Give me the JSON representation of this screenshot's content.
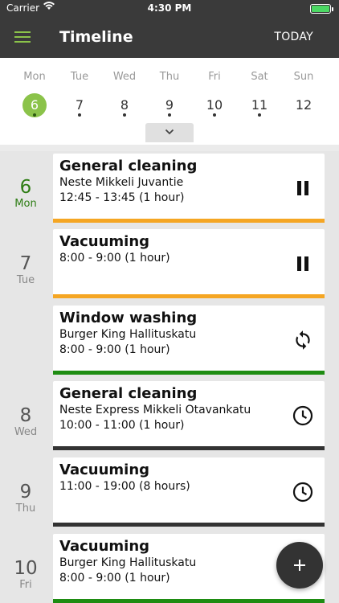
{
  "status_bar": {
    "carrier": "Carrier",
    "time": "4:30 PM"
  },
  "app_bar": {
    "title": "Timeline",
    "today_label": "TODAY"
  },
  "week": {
    "days": [
      {
        "name": "Mon",
        "num": "6"
      },
      {
        "name": "Tue",
        "num": "7"
      },
      {
        "name": "Wed",
        "num": "8"
      },
      {
        "name": "Thu",
        "num": "9"
      },
      {
        "name": "Fri",
        "num": "10"
      },
      {
        "name": "Sat",
        "num": "11"
      },
      {
        "name": "Sun",
        "num": "12"
      }
    ],
    "selected": "6"
  },
  "timeline": {
    "dates": [
      {
        "num": "6",
        "weekday": "Mon"
      },
      {
        "num": "7",
        "weekday": "Tue"
      },
      {
        "num": "8",
        "weekday": "Wed"
      },
      {
        "num": "9",
        "weekday": "Thu"
      },
      {
        "num": "10",
        "weekday": "Fri"
      }
    ],
    "tasks": [
      {
        "title": "General cleaning",
        "location": "Neste Mikkeli Juvantie",
        "time": "12:45 - 13:45 (1 hour)",
        "icon": "pause-icon",
        "color": "#f5a623"
      },
      {
        "title": "Vacuuming",
        "location": "",
        "time": "8:00 - 9:00 (1 hour)",
        "icon": "pause-icon",
        "color": "#f5a623"
      },
      {
        "title": "Window washing",
        "location": "Burger King Hallituskatu",
        "time": "8:00 - 9:00 (1 hour)",
        "icon": "sync-icon",
        "color": "#1e8c12"
      },
      {
        "title": "General cleaning",
        "location": "Neste Express Mikkeli Otavankatu",
        "time": "10:00 - 11:00 (1 hour)",
        "icon": "clock-icon",
        "color": "#333333"
      },
      {
        "title": "Vacuuming",
        "location": "",
        "time": "11:00 - 19:00 (8 hours)",
        "icon": "clock-icon",
        "color": "#333333"
      },
      {
        "title": "Vacuuming",
        "location": "Burger King Hallituskatu",
        "time": "8:00 - 9:00 (1 hour)",
        "icon": "",
        "color": "#1e8c12"
      }
    ]
  },
  "colors": {
    "accent": "#8bc34a",
    "appbar": "#3a3a3a",
    "today_green": "#2e7d14"
  }
}
